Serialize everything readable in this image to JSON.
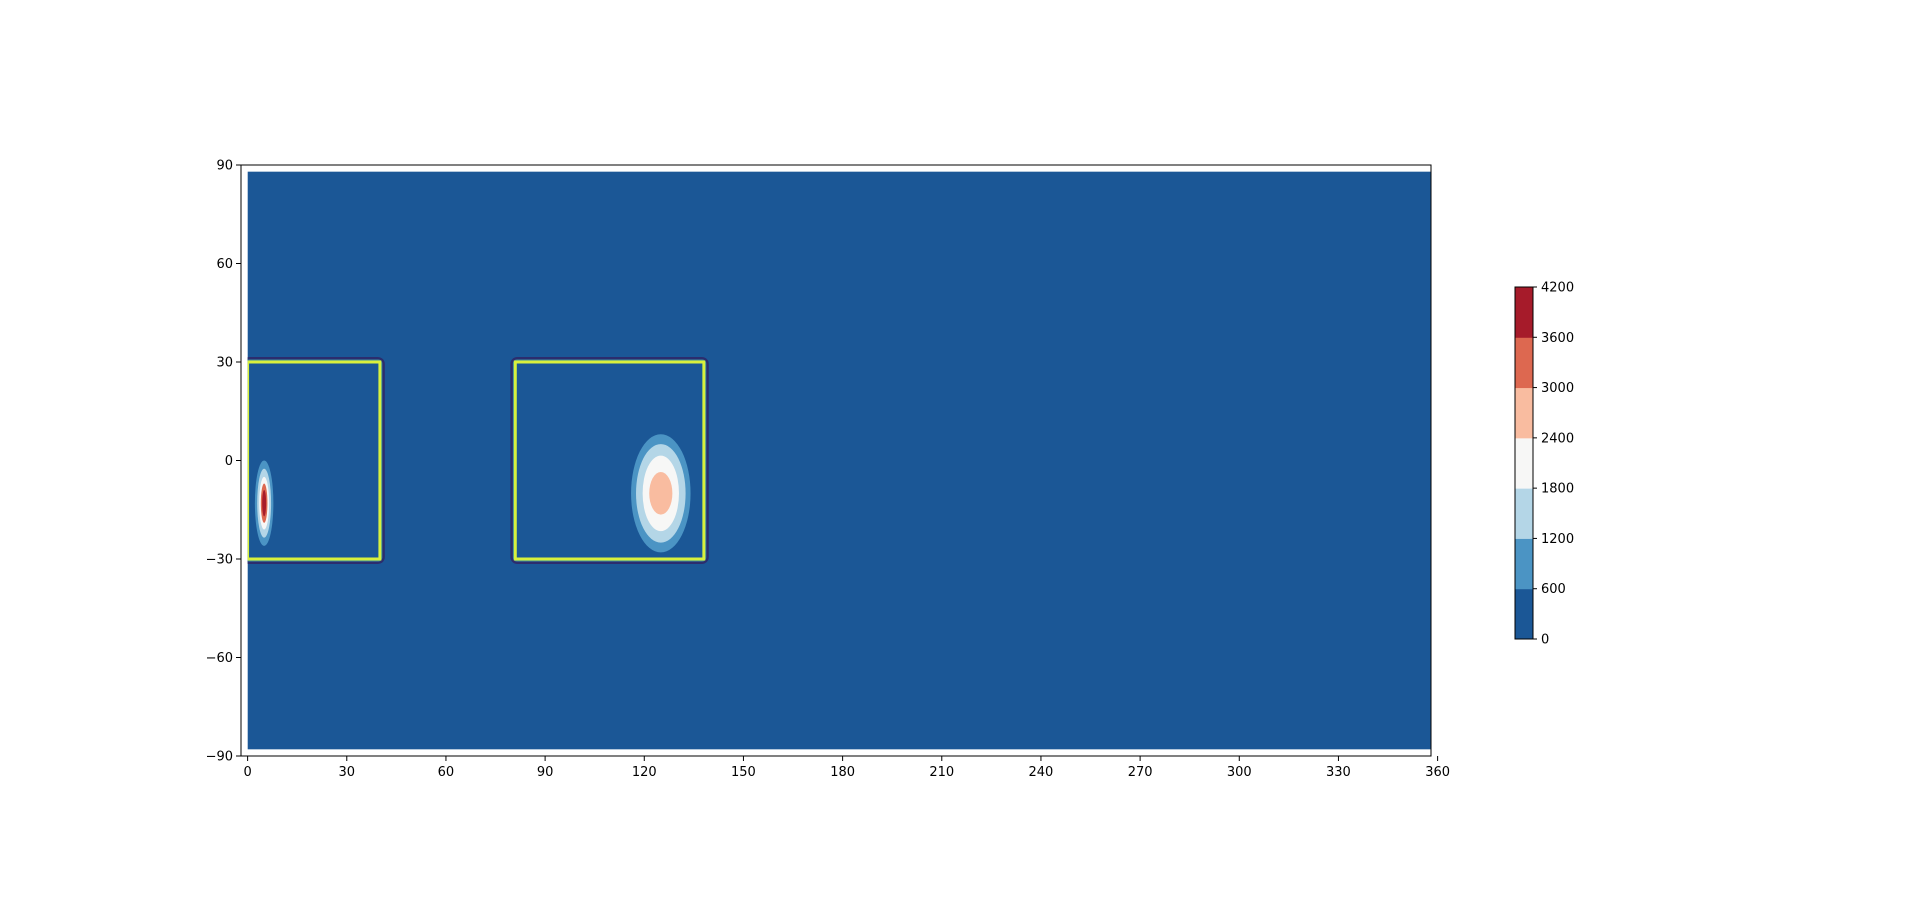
{
  "chart_data": {
    "type": "heatmap",
    "subtype": "filled-contour",
    "title": "",
    "xlabel": "",
    "ylabel": "",
    "xlim": [
      -2,
      358
    ],
    "ylim": [
      -90,
      90
    ],
    "x_ticks": [
      0,
      30,
      60,
      90,
      120,
      150,
      180,
      210,
      240,
      270,
      300,
      330,
      360
    ],
    "x_tick_labels": [
      "0",
      "30",
      "60",
      "90",
      "120",
      "150",
      "180",
      "210",
      "240",
      "270",
      "300",
      "330",
      "360"
    ],
    "y_ticks": [
      90,
      60,
      30,
      0,
      -30,
      -60,
      -90
    ],
    "y_tick_labels": [
      "90",
      "60",
      "30",
      "0",
      "−30",
      "−60",
      "−90"
    ],
    "data_extent": {
      "x": [
        0,
        358
      ],
      "y": [
        -88,
        88
      ]
    },
    "background_color": "#1b5796",
    "colorbar": {
      "levels": [
        0,
        600,
        1200,
        1800,
        2400,
        3000,
        3600,
        4200
      ],
      "tick_labels": [
        "0",
        "600",
        "1200",
        "1800",
        "2400",
        "3000",
        "3600",
        "4200"
      ],
      "colors": [
        "#1b5796",
        "#4b94c4",
        "#b4d6e7",
        "#f7f7f6",
        "#f9bca0",
        "#dd6850",
        "#a61b2a"
      ],
      "cmap": "RdBu_r"
    },
    "boxes": [
      {
        "x": [
          0,
          40
        ],
        "y": [
          -30,
          30
        ],
        "line_color": "#d9f03c",
        "edge_color": "#2b2d6e"
      },
      {
        "x": [
          81,
          138
        ],
        "y": [
          -30,
          30
        ],
        "line_color": "#d9f03c",
        "edge_color": "#2b2d6e"
      }
    ],
    "blobs": [
      {
        "center": [
          125,
          -10
        ],
        "rx": [
          9,
          7.5,
          5.5,
          3.5
        ],
        "ry": [
          18,
          15,
          11.5,
          6.5
        ],
        "levels": [
          600,
          1200,
          1800,
          2400
        ]
      },
      {
        "center": [
          5,
          -13
        ],
        "rx": [
          2.8,
          2.1,
          1.5,
          1.0,
          0.6
        ],
        "ry": [
          13,
          10.5,
          8,
          6,
          4
        ],
        "levels": [
          600,
          1200,
          1800,
          3000,
          3600
        ]
      }
    ]
  }
}
